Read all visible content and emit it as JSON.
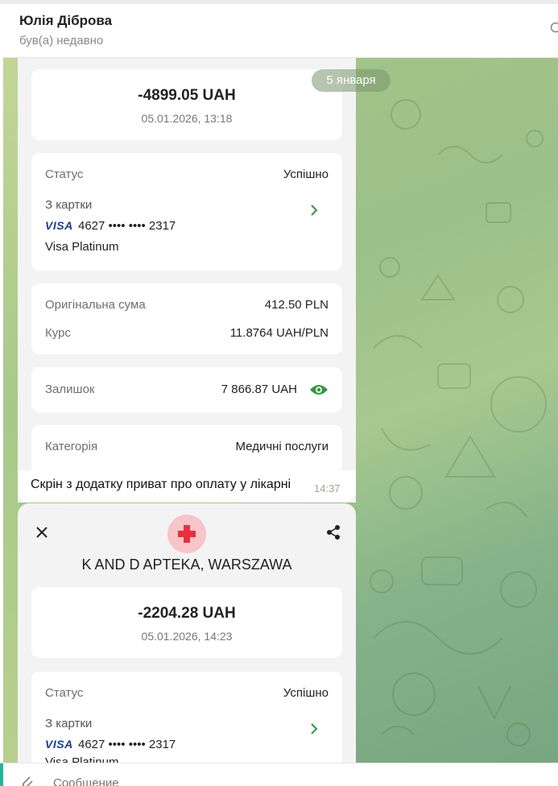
{
  "header": {
    "name": "Юлія Діброва",
    "status": "був(а) недавно",
    "search_icon": "search-icon"
  },
  "chat": {
    "date_pill": "5 января"
  },
  "message1": {
    "amount": "-4899.05 UAH",
    "datetime": "05.01.2026, 13:18",
    "status_label": "Статус",
    "status_value": "Успішно",
    "card_label": "З картки",
    "card_brand": "VISA",
    "card_number": "4627 •••• •••• 2317",
    "card_type": "Visa Platinum",
    "orig_sum_label": "Оригінальна сума",
    "orig_sum_value": "412.50 PLN",
    "rate_label": "Курс",
    "rate_value": "11.8764 UAH/PLN",
    "balance_label": "Залишок",
    "balance_value": "7 866.87 UAH",
    "category_label": "Категорія",
    "category_value": "Медичні послуги",
    "caption": "Скрін з додатку приват про оплату у лікарні",
    "time": "14:37"
  },
  "message2": {
    "merchant": "K AND D APTEKA, WARSZAWA",
    "amount": "-2204.28 UAH",
    "datetime": "05.01.2026, 14:23",
    "status_label": "Статус",
    "status_value": "Успішно",
    "card_label": "З картки",
    "card_brand": "VISA",
    "card_number": "4627 •••• •••• 2317",
    "card_type": "Visa Platinum"
  },
  "composer": {
    "placeholder": "Сообщение"
  },
  "colors": {
    "accent": "#27b59a",
    "visa_blue": "#1a3b9c",
    "eye_green": "#2e9a3a",
    "chevron_green": "#2e9a3a",
    "badge_red": "#e8303c"
  }
}
